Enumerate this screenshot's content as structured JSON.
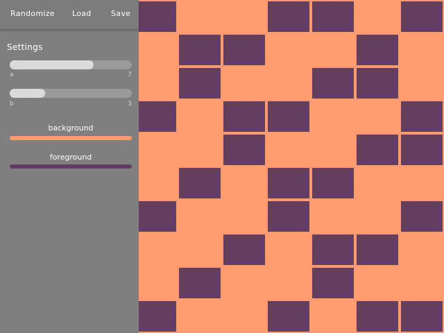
{
  "toolbar": {
    "randomize_label": "Randomize",
    "load_label": "Load",
    "save_label": "Save"
  },
  "settings": {
    "title": "Settings",
    "sliders": [
      {
        "name": "a",
        "value": 7,
        "fill_fraction": 0.69
      },
      {
        "name": "b",
        "value": 3,
        "fill_fraction": 0.29
      }
    ],
    "colors": {
      "background": {
        "label": "background",
        "value": "#FF9B6E"
      },
      "foreground": {
        "label": "foreground",
        "value": "#633E60"
      }
    }
  },
  "panel_color": "#7F7F7F",
  "pattern": {
    "rows": [
      [
        1,
        0,
        0,
        1,
        1,
        0,
        1
      ],
      [
        0,
        1,
        1,
        0,
        0,
        1,
        0
      ],
      [
        0,
        1,
        0,
        0,
        1,
        1,
        0
      ],
      [
        1,
        0,
        1,
        1,
        0,
        0,
        1
      ],
      [
        0,
        0,
        1,
        0,
        0,
        1,
        1
      ],
      [
        0,
        1,
        0,
        1,
        1,
        0,
        0
      ],
      [
        1,
        0,
        0,
        1,
        0,
        0,
        1
      ],
      [
        0,
        0,
        1,
        0,
        1,
        1,
        0
      ],
      [
        0,
        1,
        0,
        0,
        1,
        0,
        0
      ],
      [
        1,
        0,
        0,
        1,
        0,
        1,
        1
      ]
    ]
  }
}
